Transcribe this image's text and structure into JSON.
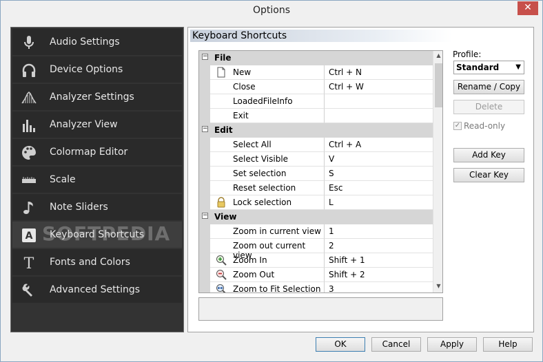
{
  "window": {
    "title": "Options",
    "close_glyph": "✕"
  },
  "sidebar": {
    "items": [
      {
        "label": "Audio Settings",
        "icon": "microphone-icon"
      },
      {
        "label": "Device Options",
        "icon": "headphones-icon"
      },
      {
        "label": "Analyzer Settings",
        "icon": "spectrum-icon"
      },
      {
        "label": "Analyzer View",
        "icon": "bars-icon"
      },
      {
        "label": "Colormap Editor",
        "icon": "palette-icon"
      },
      {
        "label": "Scale",
        "icon": "ruler-icon"
      },
      {
        "label": "Note Sliders",
        "icon": "music-note-icon"
      },
      {
        "label": "Keyboard Shortcuts",
        "icon": "key-a-icon",
        "active": true
      },
      {
        "label": "Fonts and Colors",
        "icon": "font-t-icon"
      },
      {
        "label": "Advanced Settings",
        "icon": "wrench-icon"
      }
    ]
  },
  "panel": {
    "title": "Keyboard Shortcuts"
  },
  "grid": {
    "groups": [
      {
        "name": "File",
        "rows": [
          {
            "command": "New",
            "key": "Ctrl + N",
            "icon": "new-document-icon"
          },
          {
            "command": "Close",
            "key": "Ctrl + W"
          },
          {
            "command": "LoadedFileInfo",
            "key": ""
          },
          {
            "command": "Exit",
            "key": ""
          }
        ]
      },
      {
        "name": "Edit",
        "rows": [
          {
            "command": "Select All",
            "key": "Ctrl + A"
          },
          {
            "command": "Select Visible",
            "key": "V"
          },
          {
            "command": "Set selection",
            "key": "S"
          },
          {
            "command": "Reset selection",
            "key": "Esc"
          },
          {
            "command": "Lock selection",
            "key": "L",
            "icon": "lock-icon"
          }
        ]
      },
      {
        "name": "View",
        "rows": [
          {
            "command": "Zoom in current view",
            "key": "1"
          },
          {
            "command": "Zoom out current view",
            "key": "2"
          },
          {
            "command": "Zoom In",
            "key": "Shift + 1",
            "icon": "zoom-in-icon"
          },
          {
            "command": "Zoom Out",
            "key": "Shift + 2",
            "icon": "zoom-out-icon"
          },
          {
            "command": "Zoom to Fit Selection",
            "key": "3",
            "icon": "zoom-fit-icon"
          }
        ]
      }
    ]
  },
  "profile": {
    "label": "Profile:",
    "selected": "Standard",
    "rename_copy": "Rename / Copy",
    "delete": "Delete",
    "readonly_label": "Read-only",
    "readonly_checked": true,
    "add_key": "Add Key",
    "clear_key": "Clear Key"
  },
  "footer": {
    "ok": "OK",
    "cancel": "Cancel",
    "apply": "Apply",
    "help": "Help"
  },
  "watermark": "SOFTPEDIA"
}
